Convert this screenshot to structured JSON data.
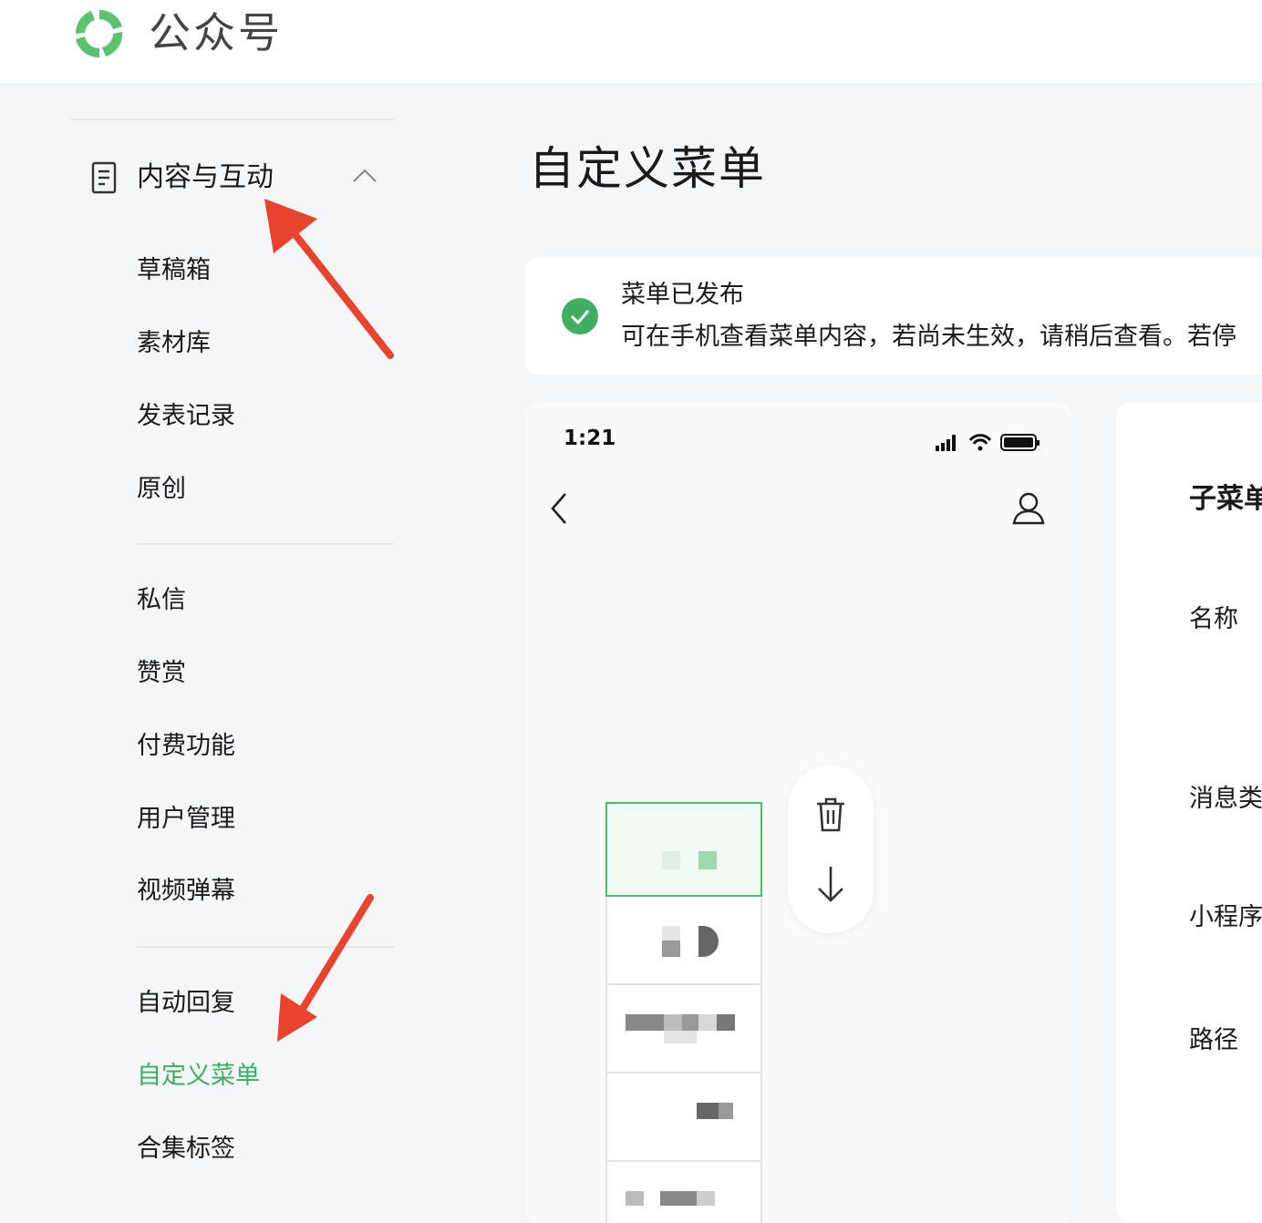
{
  "header": {
    "logo_text": "公众号",
    "logo_icon": "wechat-mp-logo-icon"
  },
  "sidebar": {
    "group": {
      "label": "内容与互动",
      "icon": "document-icon",
      "expanded": true
    },
    "items": [
      {
        "label": "草稿箱"
      },
      {
        "label": "素材库"
      },
      {
        "label": "发表记录"
      },
      {
        "label": "原创"
      },
      {
        "label": "私信"
      },
      {
        "label": "赞赏"
      },
      {
        "label": "付费功能"
      },
      {
        "label": "用户管理"
      },
      {
        "label": "视频弹幕"
      },
      {
        "label": "自动回复"
      },
      {
        "label": "自定义菜单",
        "active": true
      },
      {
        "label": "合集标签"
      }
    ]
  },
  "main": {
    "title": "自定义菜单",
    "status": {
      "title": "菜单已发布",
      "description": "可在手机查看菜单内容，若尚未生效，请稍后查看。若停",
      "icon": "check-circle-icon",
      "color": "#3fae62"
    },
    "phone": {
      "time": "1:21",
      "menu_items": [
        {
          "label": "",
          "selected": true
        },
        {
          "label": ""
        },
        {
          "label": ""
        },
        {
          "label": ""
        },
        {
          "label": ""
        }
      ]
    },
    "editor": {
      "title": "子菜单",
      "fields": [
        "名称",
        "消息类",
        "小程序",
        "路径"
      ]
    }
  },
  "colors": {
    "accent": "#3fae62",
    "annotation_arrow": "#e8432d"
  }
}
